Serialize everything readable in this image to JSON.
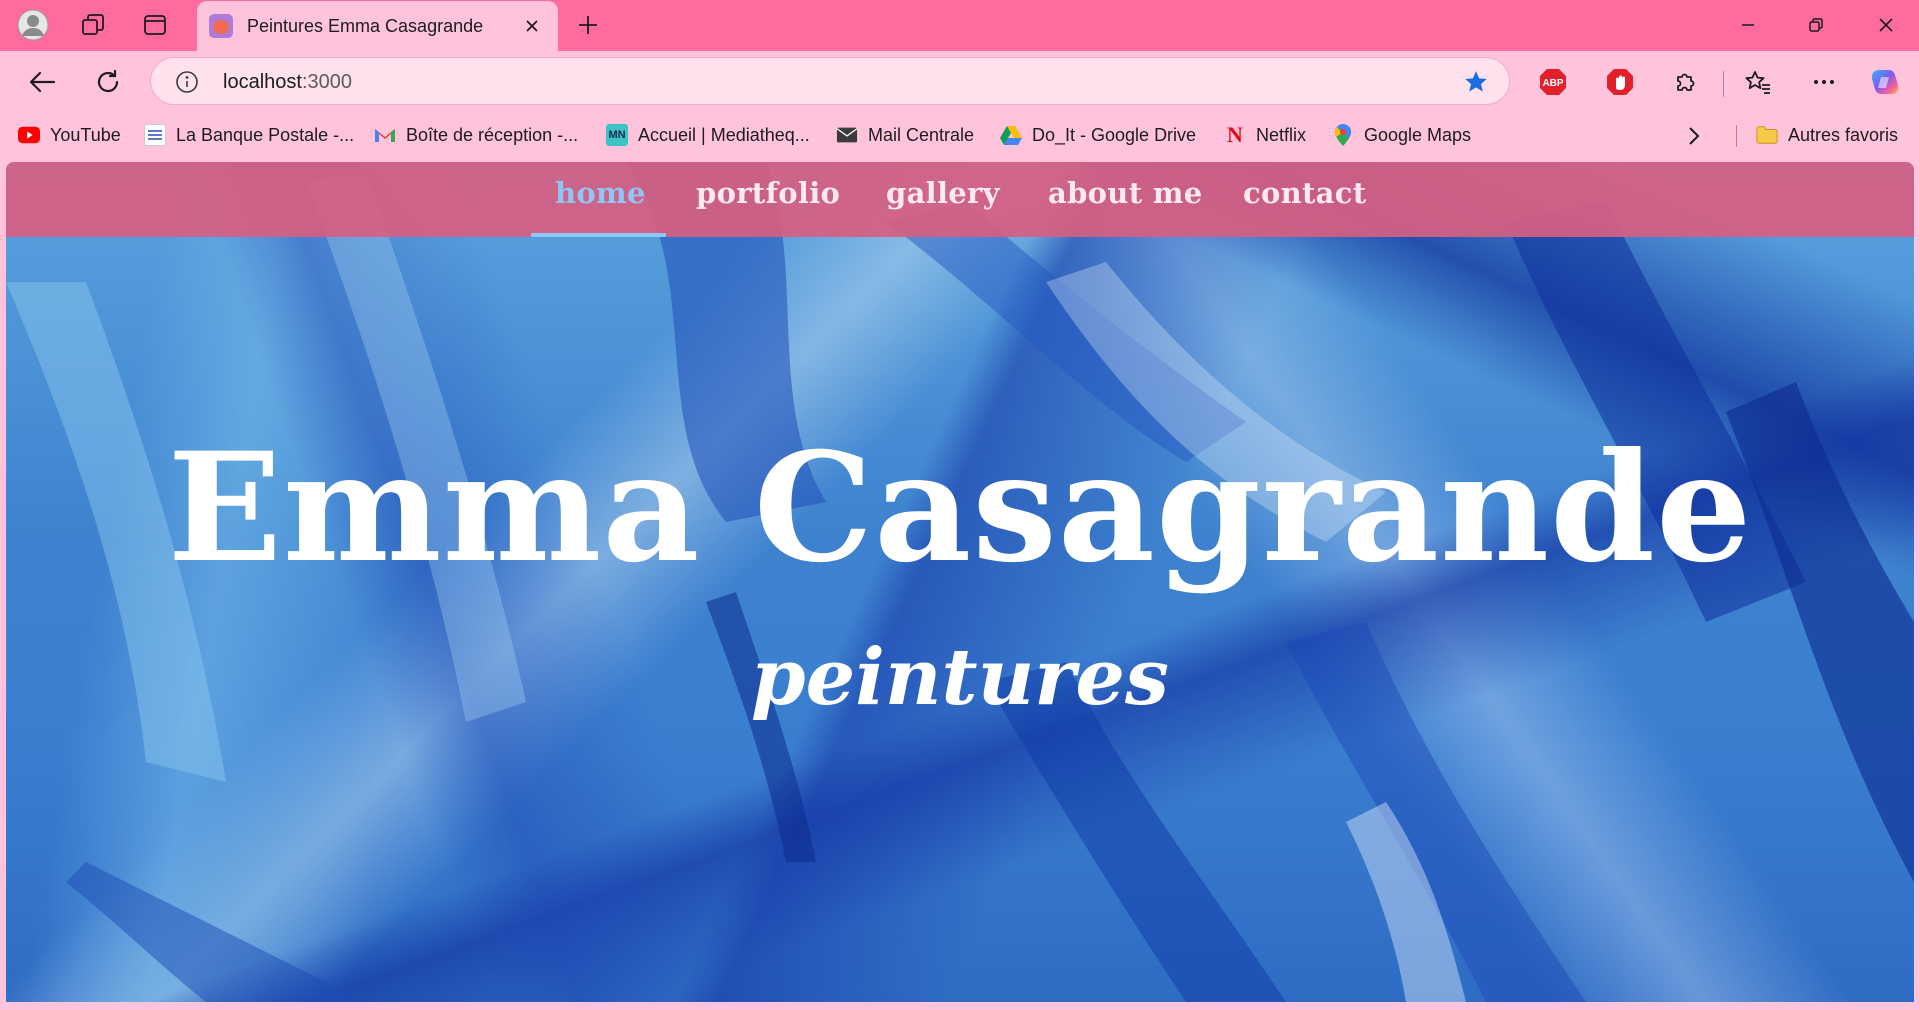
{
  "browser": {
    "tab": {
      "title": "Peintures Emma Casagrande"
    },
    "address_bar": {
      "host": "localhost",
      "port": ":3000"
    },
    "bookmarks": [
      {
        "label": "YouTube",
        "icon": "youtube-icon"
      },
      {
        "label": "La Banque Postale -...",
        "icon": "la-banque-postale-icon"
      },
      {
        "label": "Boîte de réception -...",
        "icon": "gmail-icon"
      },
      {
        "label": "Accueil | Mediatheq...",
        "icon": "mediatheque-icon",
        "icon_text": "MN"
      },
      {
        "label": "Mail Centrale",
        "icon": "mail-icon"
      },
      {
        "label": "Do_It - Google Drive",
        "icon": "google-drive-icon"
      },
      {
        "label": "Netflix",
        "icon": "netflix-icon",
        "icon_text": "N"
      },
      {
        "label": "Google Maps",
        "icon": "google-maps-icon"
      }
    ],
    "other_bookmarks": "Autres favoris",
    "extensions": [
      {
        "name": "adblock-plus-icon",
        "text": "ABP"
      },
      {
        "name": "stop-extension-icon"
      }
    ],
    "colors": {
      "titlebar": "#ff6b9e",
      "toolbar": "#ffc4dc",
      "star": "#1a6fe0"
    }
  },
  "site": {
    "nav": [
      {
        "label": "home",
        "active": true
      },
      {
        "label": "portfolio",
        "active": false
      },
      {
        "label": "gallery",
        "active": false
      },
      {
        "label": "about me",
        "active": false
      },
      {
        "label": "contact",
        "active": false
      }
    ],
    "hero": {
      "title": "Emma Casagrande",
      "subtitle": "peintures"
    },
    "colors": {
      "nav_background": "#d65f82",
      "nav_active": "#8fc6f4",
      "nav_text": "#fde9ef",
      "hero_text": "#ffffff"
    }
  }
}
